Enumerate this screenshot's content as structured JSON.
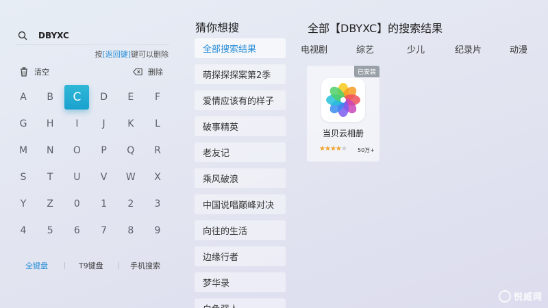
{
  "search": {
    "value": "DBYXC",
    "hint_prefix": "按",
    "hint_key": "[返回键]",
    "hint_suffix": "键可以删除"
  },
  "actions": {
    "clear": "清空",
    "delete": "删除"
  },
  "keyboard": {
    "rows": [
      [
        "A",
        "B",
        "C",
        "D",
        "E",
        "F"
      ],
      [
        "G",
        "H",
        "I",
        "J",
        "K",
        "L"
      ],
      [
        "M",
        "N",
        "O",
        "P",
        "Q",
        "R"
      ],
      [
        "S",
        "T",
        "U",
        "V",
        "W",
        "X"
      ],
      [
        "Y",
        "Z",
        "0",
        "1",
        "2",
        "3"
      ],
      [
        "4",
        "5",
        "6",
        "7",
        "8",
        "9"
      ]
    ],
    "active_key": "C",
    "tabs": [
      "全键盘",
      "T9键盘",
      "手机搜索"
    ],
    "active_tab": "全键盘"
  },
  "suggestions": {
    "title": "猜你想搜",
    "items": [
      "全部搜索结果",
      "萌探探探案第2季",
      "爱情应该有的样子",
      "破事精英",
      "老友记",
      "乘风破浪",
      "中国说唱巅峰对决",
      "向往的生活",
      "边缘行者",
      "梦华录",
      "白色强人"
    ],
    "active": "全部搜索结果"
  },
  "results": {
    "title": "全部【DBYXC】的搜索结果",
    "categories": [
      "电视剧",
      "综艺",
      "少儿",
      "纪录片",
      "动漫"
    ],
    "apps": [
      {
        "name": "当贝云相册",
        "badge": "已安装",
        "rating": 4,
        "downloads": "50万+"
      }
    ]
  },
  "watermark": "悦威网",
  "colors": {
    "accent": "#2a8fd6",
    "key_active": "#1aa2cf",
    "star": "#f0a22a"
  }
}
